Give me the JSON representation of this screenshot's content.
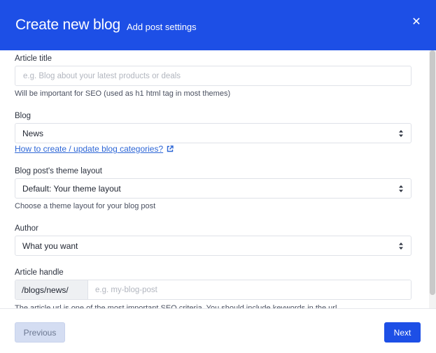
{
  "header": {
    "title": "Create new blog",
    "subtitle": "Add post settings",
    "close_glyph": "✕"
  },
  "fields": {
    "article_title": {
      "label": "Article title",
      "placeholder": "e.g. Blog about your latest products or deals",
      "value": "",
      "help": "Will be important for SEO (used as h1 html tag in most themes)"
    },
    "blog": {
      "label": "Blog",
      "selected": "News",
      "link": "How to create / update blog categories?"
    },
    "theme_layout": {
      "label": "Blog post's theme layout",
      "selected": "Default: Your theme layout",
      "help": "Choose a theme layout for your blog post"
    },
    "author": {
      "label": "Author",
      "selected": "What you want"
    },
    "article_handle": {
      "label": "Article handle",
      "prefix": "/blogs/news/",
      "placeholder": "e.g. my-blog-post",
      "value": "",
      "help": "The article url is one of the most important SEO criteria. You should include keywords in the url"
    }
  },
  "footer": {
    "previous_label": "Previous",
    "next_label": "Next"
  },
  "colors": {
    "primary": "#1d4fe6",
    "link": "#2d66d6",
    "disabled_button": "#d4ddf2"
  },
  "icons": [
    "close-icon",
    "select-arrows-icon",
    "external-link-icon"
  ]
}
